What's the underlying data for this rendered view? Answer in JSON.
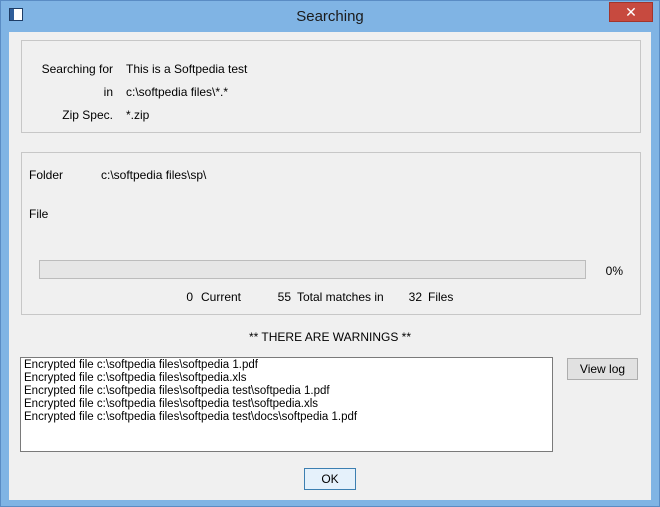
{
  "window": {
    "title": "Searching",
    "close_symbol": "✕"
  },
  "criteria": {
    "searching_for_label": "Searching for",
    "searching_for_value": "This is a Softpedia test",
    "in_label": "in",
    "in_value": "c:\\softpedia files\\*.*",
    "zip_spec_label": "Zip Spec.",
    "zip_spec_value": "*.zip"
  },
  "progress": {
    "folder_label": "Folder",
    "folder_value": "c:\\softpedia files\\sp\\",
    "file_label": "File",
    "file_value": "",
    "percent": 0,
    "percent_text": "0%",
    "current_count": "0",
    "current_label": "Current",
    "total_matches_count": "55",
    "total_matches_label": "Total matches in",
    "files_count": "32",
    "files_label": "Files"
  },
  "warning_text": "** THERE ARE WARNINGS **",
  "warnings_list": [
    "Encrypted file c:\\softpedia files\\softpedia 1.pdf",
    "Encrypted file c:\\softpedia files\\softpedia.xls",
    "Encrypted file c:\\softpedia files\\softpedia test\\softpedia 1.pdf",
    "Encrypted file c:\\softpedia files\\softpedia test\\softpedia.xls",
    "Encrypted file c:\\softpedia files\\softpedia test\\docs\\softpedia 1.pdf"
  ],
  "buttons": {
    "view_log": "View log",
    "ok": "OK"
  },
  "colors": {
    "titlebar": "#80b4e4",
    "close": "#c74a3f",
    "progress_fill": "#06b025"
  }
}
